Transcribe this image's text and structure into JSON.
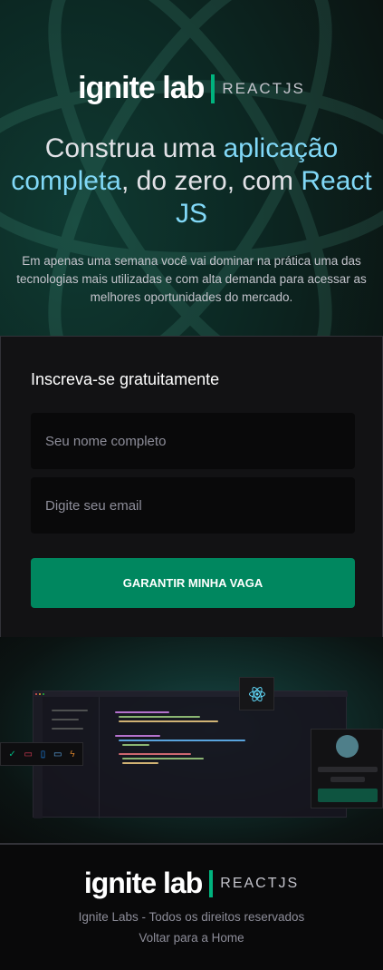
{
  "header": {
    "brand": "ignite lab",
    "tag": "REACTJS"
  },
  "hero": {
    "title_parts": [
      "Construa uma ",
      "aplicação completa",
      ", do zero, com ",
      "React JS"
    ],
    "description": "Em apenas uma semana você vai dominar na prática uma das tecnologias mais utilizadas e com alta demanda para acessar as melhores oportunidades do mercado."
  },
  "form": {
    "title": "Inscreva-se gratuitamente",
    "name_placeholder": "Seu nome completo",
    "name_value": "",
    "email_placeholder": "Digite seu email",
    "email_value": "",
    "submit_label": "GARANTIR MINHA VAGA"
  },
  "footer": {
    "brand": "ignite lab",
    "tag": "REACTJS",
    "copyright": "Ignite Labs - Todos os direitos reservados",
    "home_link": "Voltar para a Home"
  },
  "colors": {
    "accent_blue": "#81d8f7",
    "accent_green": "#00b37e",
    "button": "#00875f",
    "background": "#09090a",
    "card": "#121214"
  },
  "icons": [
    "react-atom-icon",
    "check-circle-icon",
    "video-icon",
    "mobile-icon",
    "monitor-icon",
    "lightning-icon"
  ]
}
